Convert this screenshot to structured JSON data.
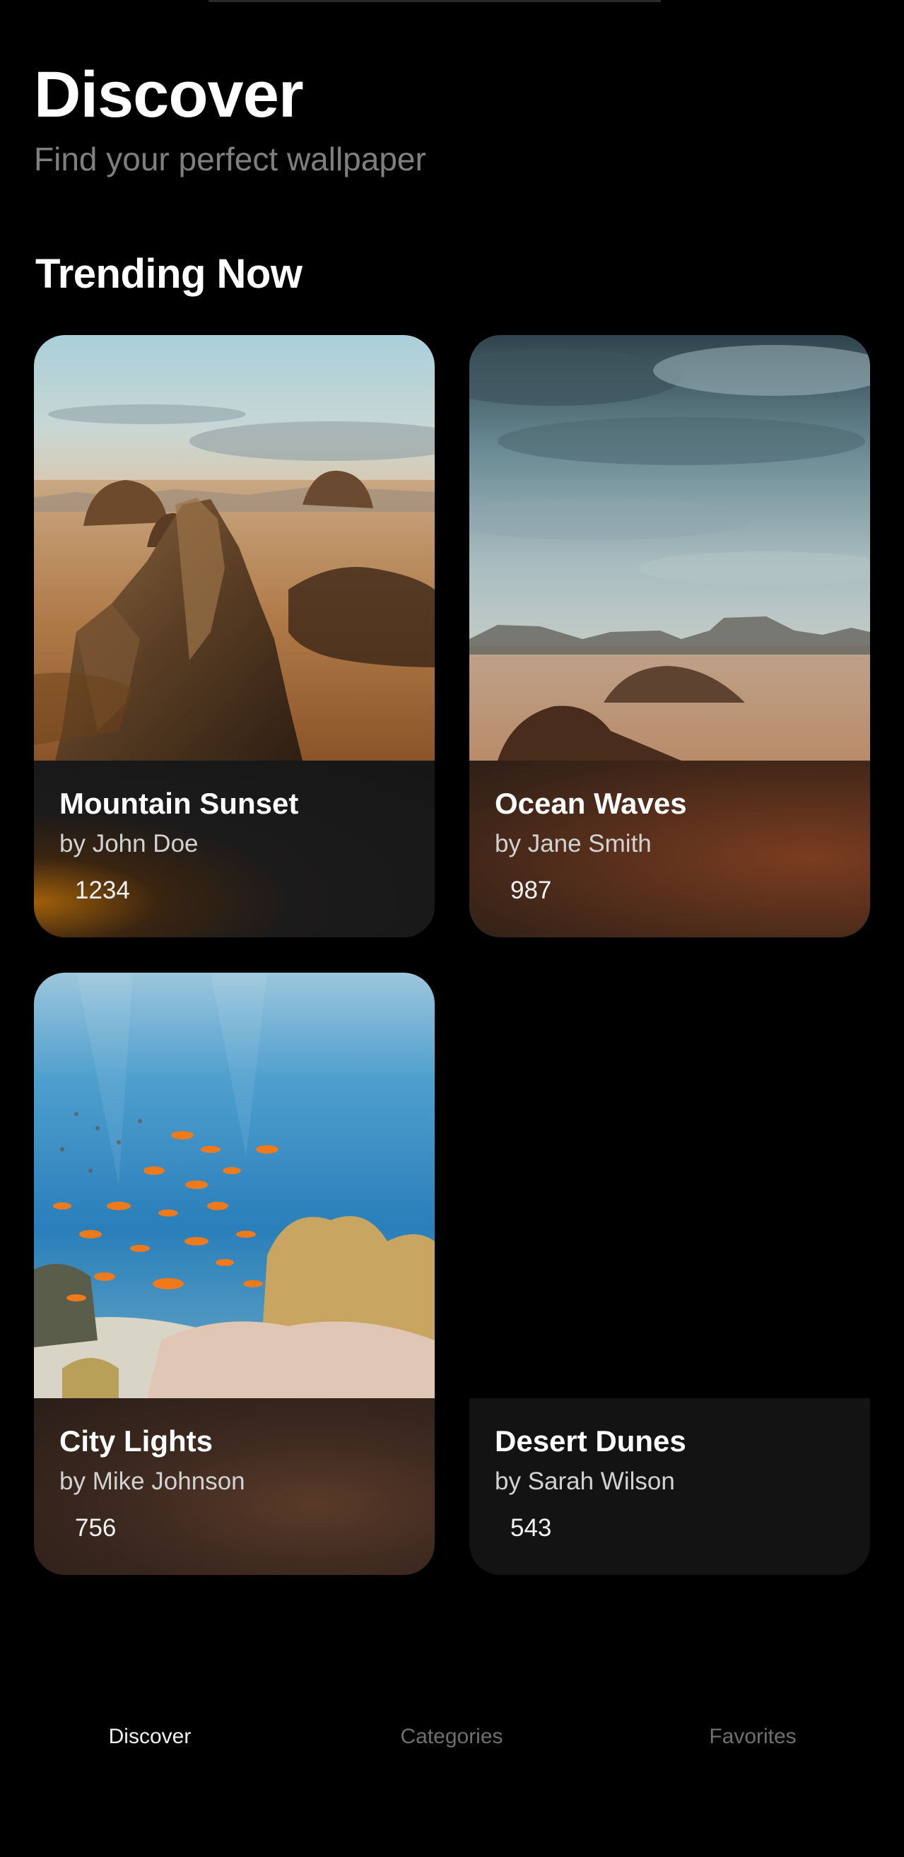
{
  "header": {
    "title": "Discover",
    "subtitle": "Find your perfect wallpaper"
  },
  "section": {
    "title": "Trending Now"
  },
  "wallpapers": [
    {
      "title": "Mountain Sunset",
      "author": "by John Doe",
      "likes": "1234",
      "image": "desert-rock-formations"
    },
    {
      "title": "Ocean Waves",
      "author": "by Jane Smith",
      "likes": "987",
      "image": "cloudy-desert-plain"
    },
    {
      "title": "City Lights",
      "author": "by Mike Johnson",
      "likes": "756",
      "image": "coral-reef-fish"
    },
    {
      "title": "Desert Dunes",
      "author": "by Sarah Wilson",
      "likes": "543",
      "image": ""
    }
  ],
  "tabs": [
    {
      "label": "Discover",
      "active": true
    },
    {
      "label": "Categories",
      "active": false
    },
    {
      "label": "Favorites",
      "active": false
    }
  ],
  "colors": {
    "background": "#000000",
    "subtitle": "#7f7f7f",
    "tab_active": "#f0f0f0",
    "tab_inactive": "#6f6f6f"
  }
}
